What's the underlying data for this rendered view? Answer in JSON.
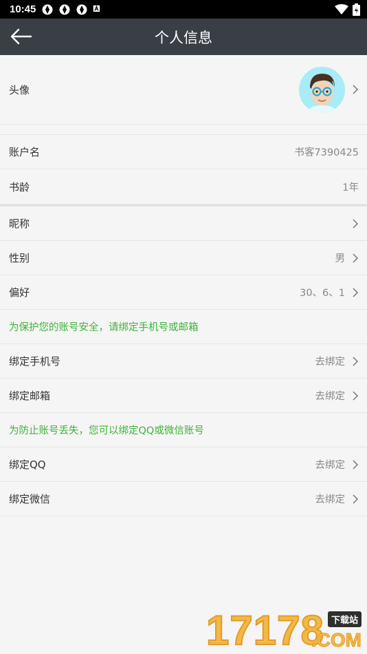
{
  "statusbar": {
    "time": "10:45"
  },
  "header": {
    "title": "个人信息"
  },
  "rows": {
    "avatar": {
      "label": "头像"
    },
    "account": {
      "label": "账户名",
      "value": "书客7390425"
    },
    "age": {
      "label": "书龄",
      "value": "1年"
    },
    "nickname": {
      "label": "昵称",
      "value": ""
    },
    "gender": {
      "label": "性别",
      "value": "男"
    },
    "preference": {
      "label": "偏好",
      "value": "30、6、1"
    },
    "phone": {
      "label": "绑定手机号",
      "value": "去绑定"
    },
    "email": {
      "label": "绑定邮箱",
      "value": "去绑定"
    },
    "qq": {
      "label": "绑定QQ",
      "value": "去绑定"
    },
    "wechat": {
      "label": "绑定微信",
      "value": "去绑定"
    }
  },
  "notices": {
    "security": "为保护您的账号安全，请绑定手机号或邮箱",
    "loss": "为防止账号丢失，您可以绑定QQ或微信账号"
  },
  "watermark": {
    "digits": "17178",
    "badge": "下载站",
    "suffix": ".COM"
  },
  "colors": {
    "header_bg": "#3a3f46",
    "notice_green": "#3fb33a",
    "avatar_bg": "#a8ecf7"
  }
}
